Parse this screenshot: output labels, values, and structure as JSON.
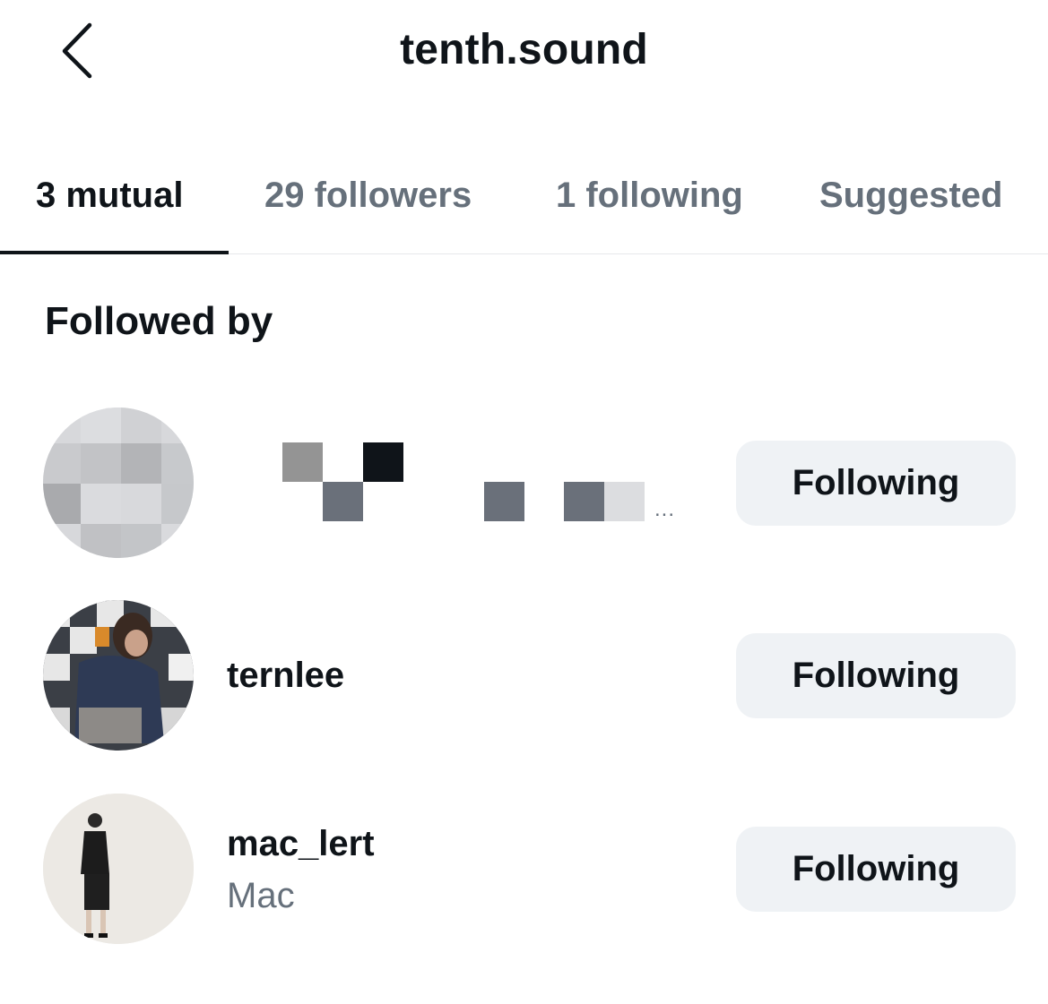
{
  "header": {
    "title": "tenth.sound",
    "back_icon": "chevron-left-icon"
  },
  "tabs": [
    {
      "label": "3 mutual",
      "active": true
    },
    {
      "label": "29 followers",
      "active": false
    },
    {
      "label": "1 following",
      "active": false
    },
    {
      "label": "Suggested",
      "active": false
    }
  ],
  "section": {
    "title": "Followed by"
  },
  "users": [
    {
      "username": "",
      "full_name": "",
      "button_label": "Following",
      "censored": true
    },
    {
      "username": "ternlee",
      "full_name": "",
      "button_label": "Following"
    },
    {
      "username": "mac_lert",
      "full_name": "Mac",
      "button_label": "Following"
    }
  ],
  "censored_suffix": "...",
  "colors": {
    "text_primary": "#0f1419",
    "text_secondary": "#66707b",
    "button_bg": "#eff2f5",
    "divider": "#e6e8eb"
  }
}
